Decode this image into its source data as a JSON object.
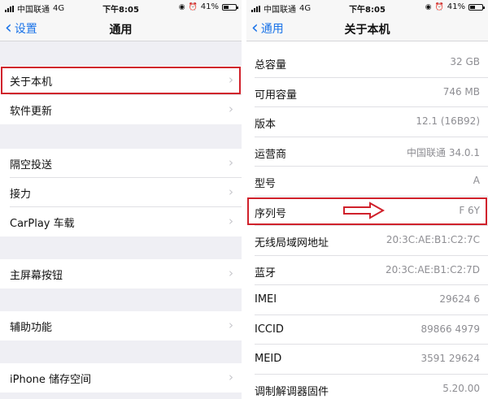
{
  "left": {
    "status": {
      "carrier": "中国联通",
      "network": "4G",
      "time": "下午8:05",
      "battery": "41%",
      "battery_level": 0.41
    },
    "nav": {
      "back_label": "设置",
      "title": "通用"
    },
    "sections": [
      [
        {
          "label": "关于本机",
          "highlight": true
        },
        {
          "label": "软件更新"
        }
      ],
      [
        {
          "label": "隔空投送"
        },
        {
          "label": "接力"
        },
        {
          "label": "CarPlay 车载"
        }
      ],
      [
        {
          "label": "主屏幕按钮"
        }
      ],
      [
        {
          "label": "辅助功能"
        }
      ],
      [
        {
          "label": "iPhone 储存空间"
        }
      ]
    ]
  },
  "right": {
    "status": {
      "carrier": "中国联通",
      "network": "4G",
      "time": "下午8:05",
      "battery": "41%",
      "battery_level": 0.41
    },
    "nav": {
      "back_label": "通用",
      "title": "关于本机"
    },
    "rows": [
      {
        "label": "总容量",
        "value": "32 GB"
      },
      {
        "label": "可用容量",
        "value": "746 MB"
      },
      {
        "label": "版本",
        "value": "12.1 (16B92)"
      },
      {
        "label": "运营商",
        "value": "中国联通 34.0.1"
      },
      {
        "label": "型号",
        "value": "A"
      },
      {
        "label": "序列号",
        "value": "F            6Y"
      },
      {
        "label": "无线局域网地址",
        "value": "20:3C:AE:B1:C2:7C"
      },
      {
        "label": "蓝牙",
        "value": "20:3C:AE:B1:C2:7D"
      },
      {
        "label": "IMEI",
        "value": "29624 6"
      },
      {
        "label": "ICCID",
        "value": "89866          4979"
      },
      {
        "label": "MEID",
        "value": "3591          29624"
      },
      {
        "label": "调制解调器固件",
        "value": "5.20.00"
      }
    ]
  },
  "colors": {
    "accent": "#1a73e8",
    "highlight": "#d0212b",
    "background": "#efeff4"
  },
  "icons": [
    "signal-bars-icon",
    "alarm-icon",
    "battery-icon",
    "chevron-left-icon",
    "chevron-right-icon",
    "red-arrow-icon"
  ]
}
